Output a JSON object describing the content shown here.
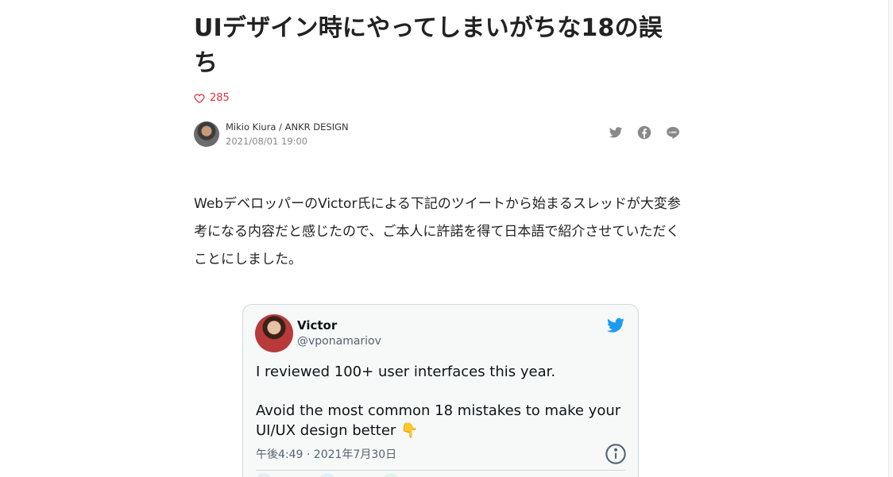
{
  "article": {
    "title": "UIデザイン時にやってしまいがちな18の誤ち",
    "likes": "285",
    "author": "Mikio Kiura / ANKR DESIGN",
    "date": "2021/08/01 19:00",
    "body": "WebデベロッパーのVictor氏による下記のツイートから始まるスレッドが大変参考になる内容だと感じたので、ご本人に許諾を得て日本語で紹介させていただくことにしました。"
  },
  "share": {
    "icons": [
      "twitter-icon",
      "facebook-icon",
      "line-icon"
    ]
  },
  "tweet": {
    "name": "Victor",
    "handle": "@vponamariov",
    "line1": "I reviewed 100+ user interfaces this year.",
    "line2": "Avoid the most common 18 mistakes to make your UI/UX design better 👇",
    "time": "午後4:49 · 2021年7月30日"
  },
  "colors": {
    "accent_red": "#e0313e",
    "twitter_blue": "#1d9bf0",
    "text": "#222222",
    "muted": "#888888"
  }
}
